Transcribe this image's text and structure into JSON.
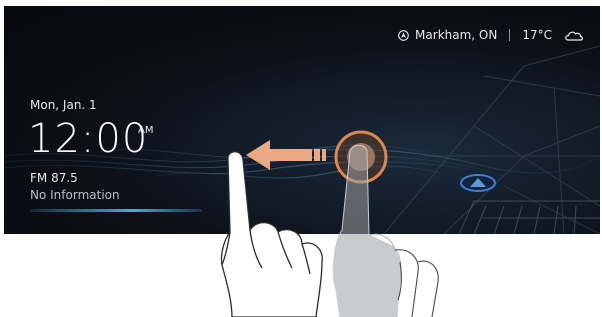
{
  "status": {
    "location_icon": "navigation-icon",
    "location": "Markham, ON",
    "temperature": "17°C",
    "weather_icon": "cloud-icon"
  },
  "clock": {
    "date": "Mon, Jan. 1",
    "time": "12:00",
    "ampm": "AM"
  },
  "radio": {
    "station": "FM 87.5",
    "info": "No Information"
  },
  "colors": {
    "screen_bg": "#0c1017",
    "accent": "#3fb1d8",
    "touch_ring": "#e0874a",
    "car_marker": "#3f7fd6"
  },
  "gesture": {
    "direction": "swipe-left",
    "icons": [
      "left-arrow-icon",
      "touch-point-icon",
      "hand-icon"
    ]
  }
}
